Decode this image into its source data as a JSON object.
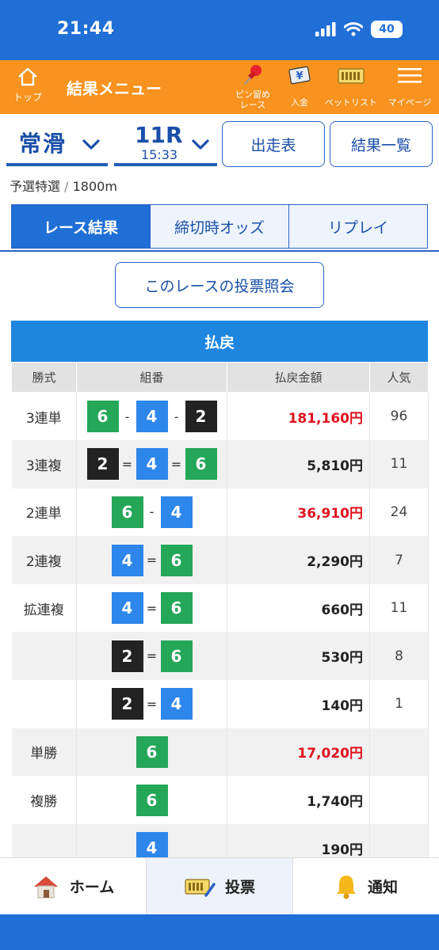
{
  "status": {
    "time": "21:44",
    "battery": "40"
  },
  "header": {
    "home_label": "トップ",
    "title": "結果メニュー",
    "pin_label_1": "ピン留め",
    "pin_label_2": "レース",
    "deposit_label": "入金",
    "betlist_label": "ベットリスト",
    "mypage_label": "マイページ",
    "deposit_glyph": "¥"
  },
  "selector": {
    "venue": "常滑",
    "race_no": "11R",
    "race_time": "15:33",
    "entry_button": "出走表",
    "results_button": "結果一覧"
  },
  "race_info": {
    "grade": "予選特選",
    "divider": "/",
    "distance": "1800m"
  },
  "tabs": [
    {
      "label": "レース結果"
    },
    {
      "label": "締切時オッズ"
    },
    {
      "label": "リプレイ"
    }
  ],
  "vote_lookup_button": "このレースの投票照会",
  "payout": {
    "heading": "払戻",
    "columns": {
      "type": "勝式",
      "combo": "組番",
      "amount": "払戻金額",
      "popularity": "人気"
    },
    "rows": [
      {
        "type": "3連単",
        "boats": [
          "6",
          "4",
          "2"
        ],
        "sep": "-",
        "amount": "181,160円",
        "popularity": "96",
        "highlight": true
      },
      {
        "type": "3連複",
        "boats": [
          "2",
          "4",
          "6"
        ],
        "sep": "=",
        "amount": "5,810円",
        "popularity": "11",
        "highlight": false
      },
      {
        "type": "2連単",
        "boats": [
          "6",
          "4"
        ],
        "sep": "-",
        "amount": "36,910円",
        "popularity": "24",
        "highlight": true
      },
      {
        "type": "2連複",
        "boats": [
          "4",
          "6"
        ],
        "sep": "=",
        "amount": "2,290円",
        "popularity": "7",
        "highlight": false
      },
      {
        "type": "拡連複",
        "boats": [
          "4",
          "6"
        ],
        "sep": "=",
        "amount": "660円",
        "popularity": "11",
        "highlight": false
      },
      {
        "type": "",
        "boats": [
          "2",
          "6"
        ],
        "sep": "=",
        "amount": "530円",
        "popularity": "8",
        "highlight": false
      },
      {
        "type": "",
        "boats": [
          "2",
          "4"
        ],
        "sep": "=",
        "amount": "140円",
        "popularity": "1",
        "highlight": false
      },
      {
        "type": "単勝",
        "boats": [
          "6"
        ],
        "sep": "",
        "amount": "17,020円",
        "popularity": "",
        "highlight": true
      },
      {
        "type": "複勝",
        "boats": [
          "6"
        ],
        "sep": "",
        "amount": "1,740円",
        "popularity": "",
        "highlight": false
      },
      {
        "type": "",
        "boats": [
          "4"
        ],
        "sep": "",
        "amount": "190円",
        "popularity": "",
        "highlight": false
      }
    ]
  },
  "colors": {
    "boat_2": "#222222",
    "boat_4": "#2d86ea",
    "boat_6": "#25a75a",
    "red": "#e0121f",
    "brand_blue": "#1f6fd6",
    "header_orange": "#f7931e"
  },
  "bottom_nav": [
    {
      "label": "ホーム",
      "icon": "house-icon"
    },
    {
      "label": "投票",
      "icon": "ticket-pen-icon"
    },
    {
      "label": "通知",
      "icon": "bell-icon"
    }
  ]
}
